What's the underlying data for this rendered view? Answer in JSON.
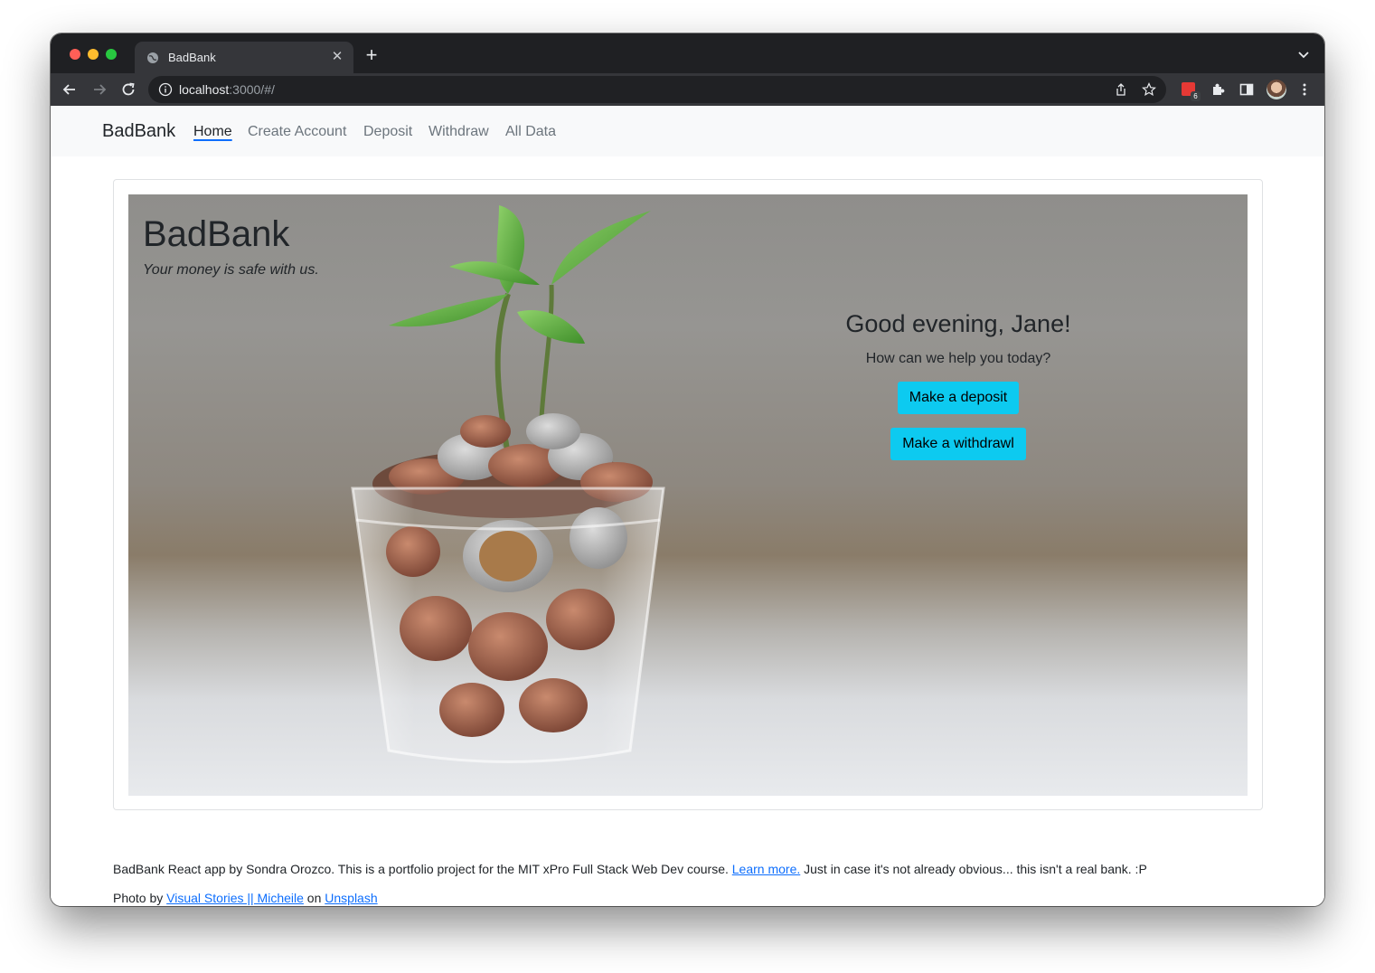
{
  "browser": {
    "tab_title": "BadBank",
    "url_host": "localhost",
    "url_rest": ":3000/#/",
    "extension_badge": "6"
  },
  "navbar": {
    "brand": "BadBank",
    "items": [
      {
        "label": "Home",
        "active": true
      },
      {
        "label": "Create Account",
        "active": false
      },
      {
        "label": "Deposit",
        "active": false
      },
      {
        "label": "Withdraw",
        "active": false
      },
      {
        "label": "All Data",
        "active": false
      }
    ]
  },
  "hero": {
    "title": "BadBank",
    "tagline": "Your money is safe with us.",
    "greeting": "Good evening, Jane!",
    "subtitle": "How can we help you today?",
    "deposit_button": "Make a deposit",
    "withdraw_button": "Make a withdrawl"
  },
  "footer": {
    "line1_text": "BadBank React app by Sondra Orozco. This is a portfolio project for the MIT xPro Full Stack Web Dev course.",
    "learn_more": "Learn more.",
    "line1_tail": "Just in case it's not already obvious... this isn't a real bank. :P",
    "photo_by": "Photo by",
    "photographer": "Visual Stories || Micheile",
    "on": "on",
    "source": "Unsplash"
  },
  "colors": {
    "accent_button": "#0dcaf0",
    "navbar_bg": "#f8f9fa",
    "link": "#0d6efd"
  }
}
